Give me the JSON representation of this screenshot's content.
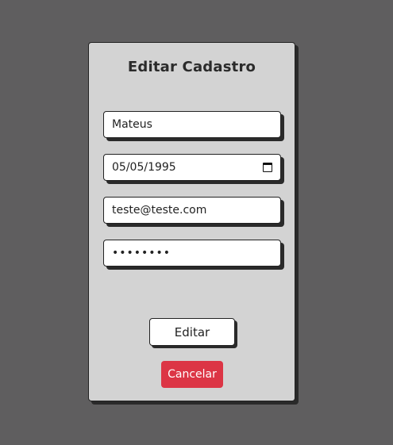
{
  "form": {
    "title": "Editar Cadastro",
    "name_value": "Mateus",
    "birthdate_value": "05/05/1995",
    "email_value": "teste@teste.com",
    "password_mask": "••••••••",
    "submit_label": "Editar",
    "cancel_label": "Cancelar"
  },
  "colors": {
    "background": "#5f5e5f",
    "card": "#d3d3d3",
    "cancel": "#dc3545"
  },
  "icons": {
    "date_picker": "calendar-icon"
  }
}
